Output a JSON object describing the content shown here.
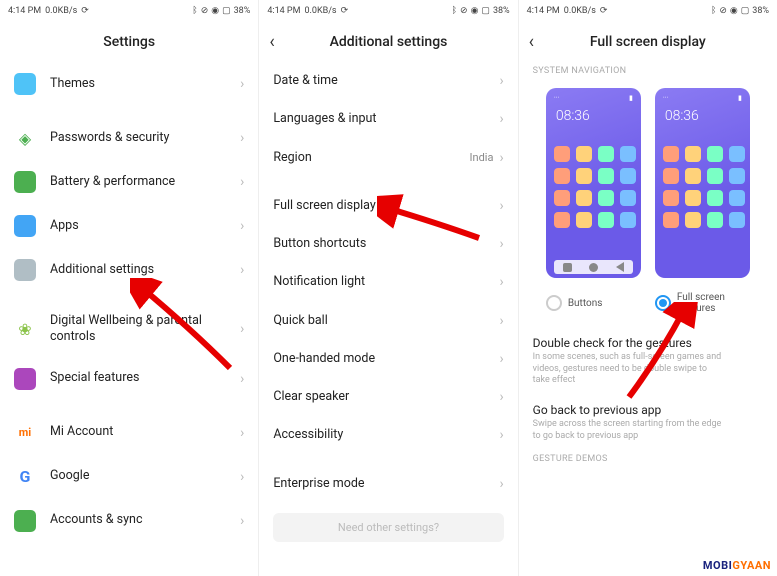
{
  "status": {
    "time": "4:14 PM",
    "net": "0.0KB/s",
    "battery": "38%"
  },
  "screen1": {
    "title": "Settings",
    "items": [
      {
        "label": "Themes",
        "icon": "themes"
      },
      {
        "label": "Passwords & security",
        "icon": "pwd"
      },
      {
        "label": "Battery & performance",
        "icon": "battery"
      },
      {
        "label": "Apps",
        "icon": "apps"
      },
      {
        "label": "Additional settings",
        "icon": "additional"
      },
      {
        "label": "Digital Wellbeing & parental controls",
        "icon": "wellbeing"
      },
      {
        "label": "Special features",
        "icon": "special"
      },
      {
        "label": "Mi Account",
        "icon": "mi"
      },
      {
        "label": "Google",
        "icon": "google"
      },
      {
        "label": "Accounts & sync",
        "icon": "sync"
      }
    ]
  },
  "screen2": {
    "title": "Additional settings",
    "items": [
      {
        "label": "Date & time"
      },
      {
        "label": "Languages & input"
      },
      {
        "label": "Region",
        "value": "India"
      },
      {
        "label": "Full screen display"
      },
      {
        "label": "Button shortcuts"
      },
      {
        "label": "Notification light"
      },
      {
        "label": "Quick ball"
      },
      {
        "label": "One-handed mode"
      },
      {
        "label": "Clear speaker"
      },
      {
        "label": "Accessibility"
      },
      {
        "label": "Enterprise mode"
      }
    ],
    "footer": "Need other settings?"
  },
  "screen3": {
    "title": "Full screen display",
    "section1": "SYSTEM NAVIGATION",
    "phone_time": "08:36",
    "radios": {
      "buttons": "Buttons",
      "gestures": "Full screen gestures"
    },
    "opt1": {
      "title": "Double check for the gestures",
      "sub": "In some scenes, such as full-screen games and videos, gestures need to be double swipe to take effect"
    },
    "opt2": {
      "title": "Go back to previous app",
      "sub": "Swipe across the screen starting from the edge to go back to previous app"
    },
    "section2": "GESTURE DEMOS"
  },
  "watermark": {
    "p1": "MOBI",
    "p2": "GYAAN"
  }
}
